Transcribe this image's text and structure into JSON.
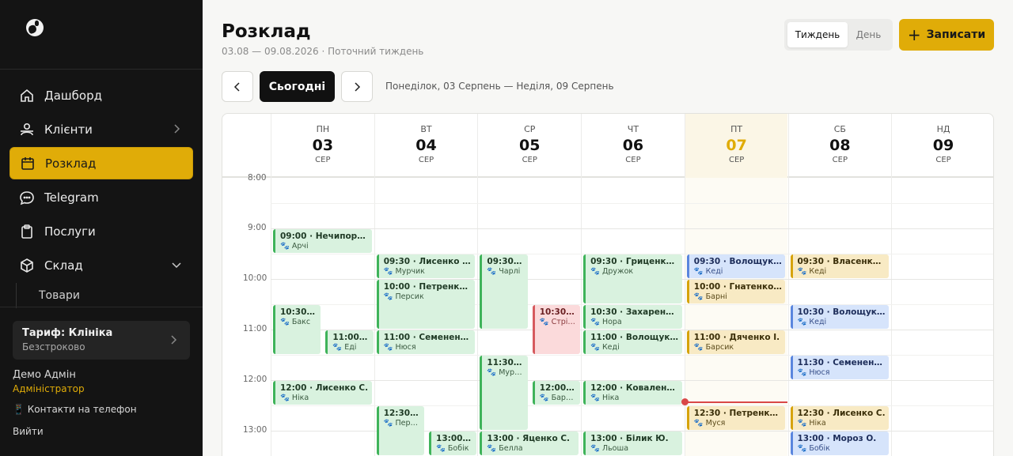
{
  "sidebar": {
    "items": [
      {
        "label": "Дашборд",
        "icon": "home-icon"
      },
      {
        "label": "Клієнти",
        "icon": "users-icon"
      },
      {
        "label": "Розклад",
        "icon": "calendar-icon"
      },
      {
        "label": "Telegram",
        "icon": "chat-icon"
      },
      {
        "label": "Послуги",
        "icon": "clipboard-icon"
      },
      {
        "label": "Склад",
        "icon": "box-icon"
      }
    ],
    "sub_item": "Товари",
    "plan_title": "Тариф: Клініка",
    "plan_sub": "Безстроково",
    "user_name": "Демо Адмін",
    "user_role": "Адміністратор",
    "contacts": "📱 Контакти на телефон",
    "logout": "Вийти"
  },
  "header": {
    "title": "Розклад",
    "subtitle": "03.08 — 09.08.2026 · Поточний тиждень",
    "view_week": "Тиждень",
    "view_day": "День",
    "book_label": "Записати",
    "today_label": "Сьогодні",
    "range": "Понеділок, 03 Серпень — Неділя, 09 Серпень"
  },
  "accent_color": "#e0ac08",
  "days": [
    {
      "dow": "ПН",
      "num": "03",
      "mon": "СЕР"
    },
    {
      "dow": "ВТ",
      "num": "04",
      "mon": "СЕР"
    },
    {
      "dow": "СР",
      "num": "05",
      "mon": "СЕР"
    },
    {
      "dow": "ЧТ",
      "num": "06",
      "mon": "СЕР"
    },
    {
      "dow": "ПТ",
      "num": "07",
      "mon": "СЕР",
      "today": true
    },
    {
      "dow": "СБ",
      "num": "08",
      "mon": "СЕР"
    },
    {
      "dow": "НД",
      "num": "09",
      "mon": "СЕР"
    }
  ],
  "hours": [
    "8:00",
    "9:00",
    "10:00",
    "11:00",
    "12:00",
    "13:00"
  ],
  "events": [
    {
      "day": 0,
      "start": "09:00",
      "dur": 30,
      "lane": 0,
      "lanes": 1,
      "title": "09:00 · Нечипорен…",
      "pet": "🐾 Арчі",
      "color": "green"
    },
    {
      "day": 0,
      "start": "10:30",
      "dur": 60,
      "lane": 0,
      "lanes": 2,
      "title": "10:30 ·…",
      "pet": "🐾 Бакс",
      "color": "green"
    },
    {
      "day": 0,
      "start": "11:00",
      "dur": 30,
      "lane": 1,
      "lanes": 2,
      "title": "11:00 ·…",
      "pet": "🐾 Еді",
      "color": "green"
    },
    {
      "day": 0,
      "start": "12:00",
      "dur": 30,
      "lane": 0,
      "lanes": 1,
      "title": "12:00 · Лисенко С.",
      "pet": "🐾 Ніка",
      "color": "green"
    },
    {
      "day": 1,
      "start": "09:30",
      "dur": 30,
      "lane": 0,
      "lanes": 1,
      "title": "09:30 · Лисенко П.",
      "pet": "🐾 Мурчик",
      "color": "green"
    },
    {
      "day": 1,
      "start": "10:00",
      "dur": 60,
      "lane": 0,
      "lanes": 1,
      "title": "10:00 · Петренко Р.",
      "pet": "🐾 Персик",
      "color": "green"
    },
    {
      "day": 1,
      "start": "11:00",
      "dur": 30,
      "lane": 0,
      "lanes": 1,
      "title": "11:00 · Семененко Р.",
      "pet": "🐾 Нюся",
      "color": "green"
    },
    {
      "day": 1,
      "start": "12:30",
      "dur": 60,
      "lane": 0,
      "lanes": 2,
      "title": "12:30 ·…",
      "pet": "🐾 Пер…",
      "color": "green"
    },
    {
      "day": 1,
      "start": "13:00",
      "dur": 30,
      "lane": 1,
      "lanes": 2,
      "title": "13:00 ·…",
      "pet": "🐾 Бобік",
      "color": "green"
    },
    {
      "day": 2,
      "start": "09:30",
      "dur": 90,
      "lane": 0,
      "lanes": 2,
      "title": "09:30 ·…",
      "pet": "🐾 Чарлі",
      "color": "green"
    },
    {
      "day": 2,
      "start": "10:30",
      "dur": 60,
      "lane": 1,
      "lanes": 2,
      "title": "10:30 ·…",
      "pet": "🐾 Стрі…",
      "color": "red"
    },
    {
      "day": 2,
      "start": "11:30",
      "dur": 90,
      "lane": 0,
      "lanes": 2,
      "title": "11:30 ·…",
      "pet": "🐾 Мур…",
      "color": "green"
    },
    {
      "day": 2,
      "start": "12:00",
      "dur": 30,
      "lane": 1,
      "lanes": 2,
      "title": "12:00 ·…",
      "pet": "🐾 Барс…",
      "color": "green"
    },
    {
      "day": 2,
      "start": "13:00",
      "dur": 30,
      "lane": 0,
      "lanes": 1,
      "title": "13:00 · Яценко С.",
      "pet": "🐾 Белла",
      "color": "green"
    },
    {
      "day": 3,
      "start": "09:30",
      "dur": 60,
      "lane": 0,
      "lanes": 1,
      "title": "09:30 · Гриценко Л.",
      "pet": "🐾 Дружок",
      "color": "green"
    },
    {
      "day": 3,
      "start": "10:30",
      "dur": 30,
      "lane": 0,
      "lanes": 1,
      "title": "10:30 · Захаренко …",
      "pet": "🐾 Нора",
      "color": "green"
    },
    {
      "day": 3,
      "start": "11:00",
      "dur": 30,
      "lane": 0,
      "lanes": 1,
      "title": "11:00 · Волощук В.",
      "pet": "🐾 Кеді",
      "color": "green"
    },
    {
      "day": 3,
      "start": "12:00",
      "dur": 30,
      "lane": 0,
      "lanes": 1,
      "title": "12:00 · Коваленко …",
      "pet": "🐾 Ніка",
      "color": "green"
    },
    {
      "day": 3,
      "start": "13:00",
      "dur": 30,
      "lane": 0,
      "lanes": 1,
      "title": "13:00 · Білик Ю.",
      "pet": "🐾 Льоша",
      "color": "green"
    },
    {
      "day": 4,
      "start": "09:30",
      "dur": 30,
      "lane": 0,
      "lanes": 1,
      "title": "09:30 · Волощук В.",
      "pet": "🐾 Кеді",
      "color": "blue"
    },
    {
      "day": 4,
      "start": "10:00",
      "dur": 30,
      "lane": 0,
      "lanes": 1,
      "title": "10:00 · Гнатенко Д.",
      "pet": "🐾 Барні",
      "color": "yellow"
    },
    {
      "day": 4,
      "start": "11:00",
      "dur": 30,
      "lane": 0,
      "lanes": 1,
      "title": "11:00 · Дяченко І.",
      "pet": "🐾 Барсик",
      "color": "yellow"
    },
    {
      "day": 4,
      "start": "12:30",
      "dur": 30,
      "lane": 0,
      "lanes": 1,
      "title": "12:30 · Петренко С.",
      "pet": "🐾 Муся",
      "color": "yellow"
    },
    {
      "day": 5,
      "start": "09:30",
      "dur": 30,
      "lane": 0,
      "lanes": 1,
      "title": "09:30 · Власенко О.",
      "pet": "🐾 Кеді",
      "color": "yellow"
    },
    {
      "day": 5,
      "start": "10:30",
      "dur": 30,
      "lane": 0,
      "lanes": 1,
      "title": "10:30 · Волощук В.",
      "pet": "🐾 Кеді",
      "color": "blue"
    },
    {
      "day": 5,
      "start": "11:30",
      "dur": 30,
      "lane": 0,
      "lanes": 1,
      "title": "11:30 · Семененко Р.",
      "pet": "🐾 Нюся",
      "color": "blue"
    },
    {
      "day": 5,
      "start": "12:30",
      "dur": 30,
      "lane": 0,
      "lanes": 1,
      "title": "12:30 · Лисенко С.",
      "pet": "🐾 Ніка",
      "color": "yellow"
    },
    {
      "day": 5,
      "start": "13:00",
      "dur": 30,
      "lane": 0,
      "lanes": 1,
      "title": "13:00 · Мороз О.",
      "pet": "🐾 Бобік",
      "color": "blue"
    }
  ],
  "now_time": "12:25"
}
